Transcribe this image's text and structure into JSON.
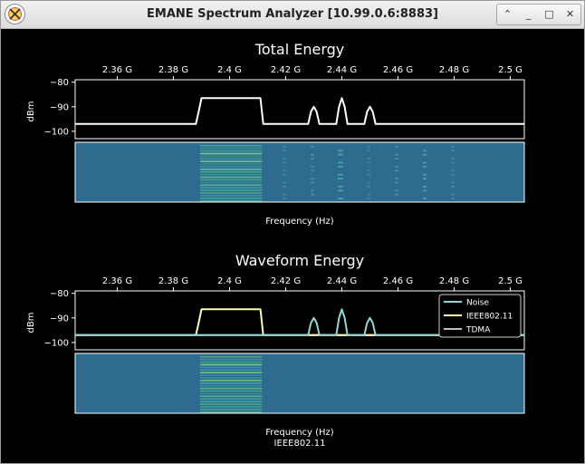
{
  "window": {
    "title": "EMANE Spectrum Analyzer [10.99.0.6:8883]",
    "buttons": {
      "up": "⌃",
      "minimize": "_",
      "maximize": "□",
      "close": "✕"
    }
  },
  "x_ticks": [
    "2.36 G",
    "2.38 G",
    "2.4 G",
    "2.42 G",
    "2.44 G",
    "2.46 G",
    "2.48 G",
    "2.5 G"
  ],
  "y_ticks": [
    "−80",
    "−90",
    "−100"
  ],
  "total": {
    "title": "Total Energy",
    "ylabel": "dBm",
    "xlabel": "Frequency (Hz)"
  },
  "waveform": {
    "title": "Waveform Energy",
    "ylabel": "dBm",
    "xlabel": "Frequency (Hz)",
    "footer": "IEEE802.11",
    "legend": [
      "Noise",
      "IEEE802.11",
      "TDMA"
    ]
  },
  "colors": {
    "noise": "#8fd6d6",
    "ieee": "#ffffb0",
    "tdma": "#c0c0c0",
    "total_line": "#ffffff",
    "waterfall_bg": "#2e6b8f"
  },
  "chart_data": [
    {
      "type": "line",
      "title": "Total Energy",
      "xlabel": "Frequency (Hz)",
      "ylabel": "dBm",
      "xlim": [
        2.345,
        2.505
      ],
      "ylim": [
        -103,
        -79
      ],
      "x_ticks": [
        2.36,
        2.38,
        2.4,
        2.42,
        2.44,
        2.46,
        2.48,
        2.5
      ],
      "y_ticks": [
        -80,
        -90,
        -100
      ],
      "series": [
        {
          "x": [
            2.345,
            2.388,
            2.389,
            2.39,
            2.411,
            2.412,
            2.428,
            2.429,
            2.43,
            2.431,
            2.432,
            2.438,
            2.439,
            2.44,
            2.441,
            2.442,
            2.448,
            2.449,
            2.45,
            2.451,
            2.452,
            2.505
          ],
          "y": [
            -97,
            -97,
            -92,
            -86.5,
            -86.5,
            -97,
            -97,
            -92,
            -90,
            -92,
            -97,
            -97,
            -90,
            -86.5,
            -90,
            -97,
            -97,
            -92,
            -90,
            -92,
            -97,
            -97
          ]
        }
      ]
    },
    {
      "type": "line",
      "title": "Waveform Energy",
      "xlabel": "Frequency (Hz)",
      "ylabel": "dBm",
      "xlim": [
        2.345,
        2.505
      ],
      "ylim": [
        -103,
        -79
      ],
      "x_ticks": [
        2.36,
        2.38,
        2.4,
        2.42,
        2.44,
        2.46,
        2.48,
        2.5
      ],
      "y_ticks": [
        -80,
        -90,
        -100
      ],
      "legend_position": "top-right",
      "series": [
        {
          "name": "Noise",
          "x": [
            2.345,
            2.428,
            2.429,
            2.43,
            2.431,
            2.432,
            2.438,
            2.439,
            2.44,
            2.441,
            2.442,
            2.448,
            2.449,
            2.45,
            2.451,
            2.452,
            2.505
          ],
          "y": [
            -97,
            -97,
            -92,
            -90,
            -92,
            -97,
            -97,
            -90,
            -86.5,
            -90,
            -97,
            -97,
            -92,
            -90,
            -92,
            -97,
            -97
          ]
        },
        {
          "name": "IEEE802.11",
          "x": [
            2.345,
            2.388,
            2.389,
            2.39,
            2.411,
            2.412,
            2.505
          ],
          "y": [
            -97,
            -97,
            -92,
            -86.5,
            -86.5,
            -97,
            -97
          ]
        },
        {
          "name": "TDMA",
          "x": [
            2.345,
            2.505
          ],
          "y": [
            -97,
            -97
          ]
        }
      ]
    }
  ]
}
